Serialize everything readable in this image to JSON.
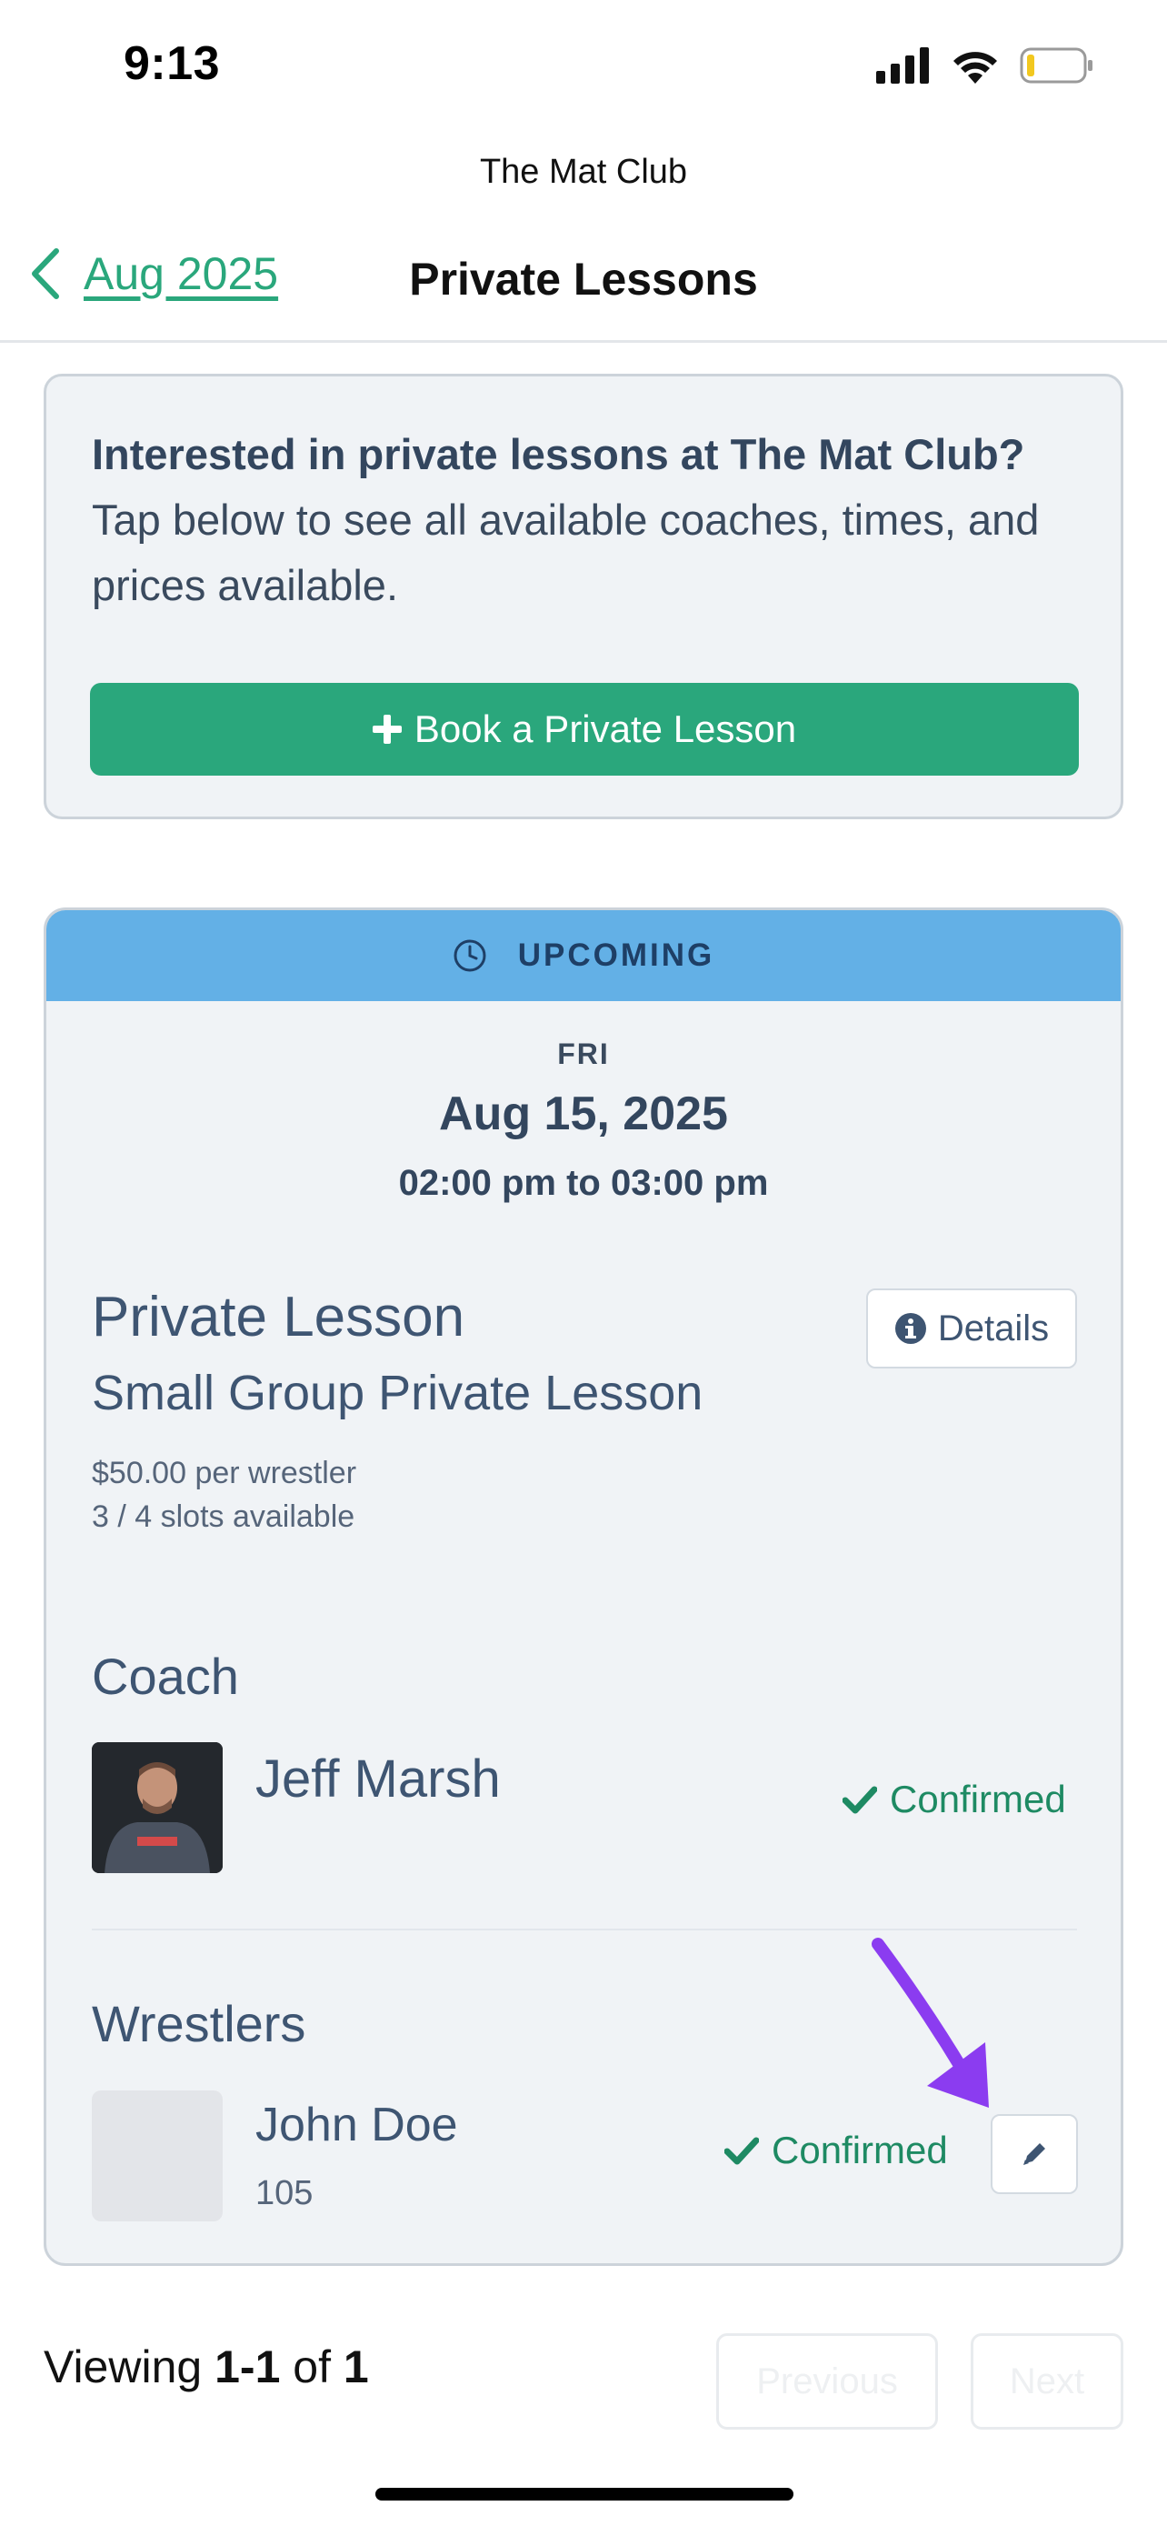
{
  "status_bar": {
    "time": "9:13"
  },
  "header": {
    "club_name": "The Mat Club",
    "back_label": "Aug 2025",
    "title": "Private Lessons"
  },
  "promo": {
    "bold_text": "Interested in private lessons at The Mat Club?",
    "body_text": " Tap below to see all available coaches, times, and prices available.",
    "button_label": "Book a Private Lesson"
  },
  "lesson": {
    "status_label": "UPCOMING",
    "day": "FRI",
    "date": "Aug 15, 2025",
    "time": "02:00 pm to 03:00 pm",
    "type": "Private Lesson",
    "subtype": "Small Group Private Lesson",
    "price": "$50.00 per wrestler",
    "slots": "3 / 4 slots available",
    "details_label": "Details",
    "coach_section": "Coach",
    "coach": {
      "name": "Jeff Marsh",
      "status": "Confirmed"
    },
    "wrestlers_section": "Wrestlers",
    "wrestlers": [
      {
        "name": "John Doe",
        "weight": "105",
        "status": "Confirmed"
      }
    ]
  },
  "pagination": {
    "prefix": "Viewing",
    "range": "1-1",
    "of": "of",
    "total": "1",
    "previous_label": "Previous",
    "next_label": "Next"
  },
  "colors": {
    "accent": "#2aa77c",
    "upcoming_banner": "#63b0e6",
    "confirmed": "#1e8a63",
    "annotation_arrow": "#8b3cf0"
  }
}
